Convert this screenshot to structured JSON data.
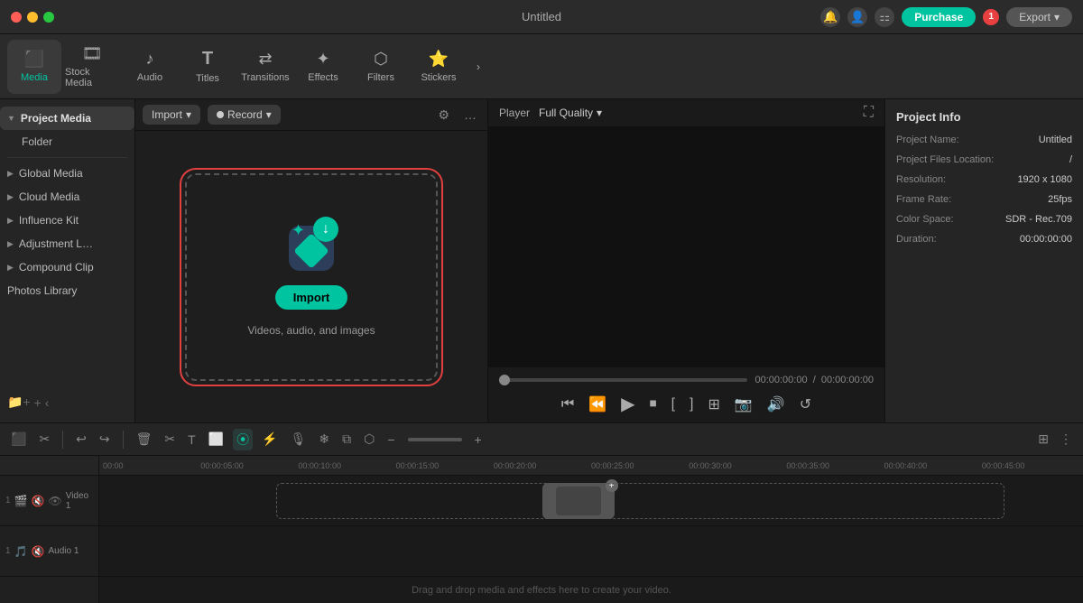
{
  "titlebar": {
    "title": "Untitled",
    "purchase_label": "Purchase",
    "export_label": "Export",
    "notif_count": "1"
  },
  "toolbar": {
    "items": [
      {
        "id": "media",
        "label": "Media",
        "icon": "⬛",
        "active": true
      },
      {
        "id": "stock",
        "label": "Stock Media",
        "icon": "🎞"
      },
      {
        "id": "audio",
        "label": "Audio",
        "icon": "🎵"
      },
      {
        "id": "titles",
        "label": "Titles",
        "icon": "T"
      },
      {
        "id": "transitions",
        "label": "Transitions",
        "icon": "⟷"
      },
      {
        "id": "effects",
        "label": "Effects",
        "icon": "✦"
      },
      {
        "id": "filters",
        "label": "Filters",
        "icon": "⬡"
      },
      {
        "id": "stickers",
        "label": "Stickers",
        "icon": "★"
      }
    ],
    "expand_icon": "›"
  },
  "sidebar": {
    "sections": [
      {
        "items": [
          {
            "id": "project-media",
            "label": "Project Media",
            "active": true,
            "expandable": true
          },
          {
            "id": "folder",
            "label": "Folder",
            "indent": true
          }
        ]
      },
      {
        "items": [
          {
            "id": "global-media",
            "label": "Global Media",
            "expandable": true
          },
          {
            "id": "cloud-media",
            "label": "Cloud Media",
            "expandable": true
          },
          {
            "id": "influence-kit",
            "label": "Influence Kit",
            "expandable": true
          },
          {
            "id": "adjustment",
            "label": "Adjustment L…",
            "expandable": true
          },
          {
            "id": "compound-clip",
            "label": "Compound Clip",
            "expandable": true
          },
          {
            "id": "photos-library",
            "label": "Photos Library"
          }
        ]
      }
    ]
  },
  "media_panel": {
    "import_label": "Import",
    "record_label": "Record",
    "import_box": {
      "btn_label": "Import",
      "subtitle": "Videos, audio, and images"
    }
  },
  "player": {
    "label": "Player",
    "quality": "Full Quality",
    "time_current": "00:00:00:00",
    "time_total": "00:00:00:00"
  },
  "project_info": {
    "title": "Project Info",
    "fields": [
      {
        "label": "Project Name:",
        "value": "Untitled"
      },
      {
        "label": "Project Files Location:",
        "value": "/"
      },
      {
        "label": "Resolution:",
        "value": "1920 x 1080"
      },
      {
        "label": "Frame Rate:",
        "value": "25fps"
      },
      {
        "label": "Color Space:",
        "value": "SDR - Rec.709"
      },
      {
        "label": "Duration:",
        "value": "00:00:00:00"
      }
    ]
  },
  "timeline": {
    "ruler_marks": [
      "00:00:00",
      "00:00:05:00",
      "00:00:10:00",
      "00:00:15:00",
      "00:00:20:00",
      "00:00:25:00",
      "00:00:30:00",
      "00:00:35:00",
      "00:00:40:00",
      "00:00:45:00"
    ],
    "tracks": [
      {
        "num": "1",
        "label": "Video 1",
        "icons": [
          "🎬",
          "🔇",
          "👁"
        ]
      },
      {
        "num": "1",
        "label": "Audio 1",
        "icons": [
          "🎵",
          "🔇"
        ]
      }
    ],
    "drop_hint": "Drag and drop media and effects here to create your video."
  }
}
